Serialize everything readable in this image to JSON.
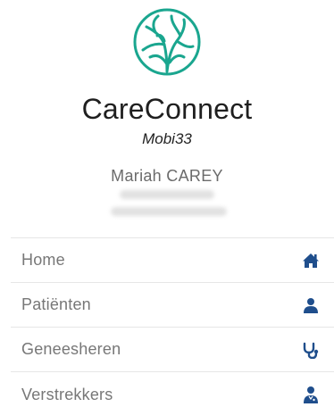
{
  "app": {
    "name": "CareConnect",
    "subtitle": "Mobi33",
    "logo_icon": "tree-roots-logo-icon",
    "logo_color": "#1aa68f"
  },
  "profile": {
    "name": "Mariah CAREY"
  },
  "menu": {
    "accent_color": "#1f4e8c",
    "items": [
      {
        "label": "Home",
        "icon": "home-icon"
      },
      {
        "label": "Patiënten",
        "icon": "user-icon"
      },
      {
        "label": "Geneesheren",
        "icon": "stethoscope-icon"
      },
      {
        "label": "Verstrekkers",
        "icon": "user-md-icon"
      }
    ]
  }
}
